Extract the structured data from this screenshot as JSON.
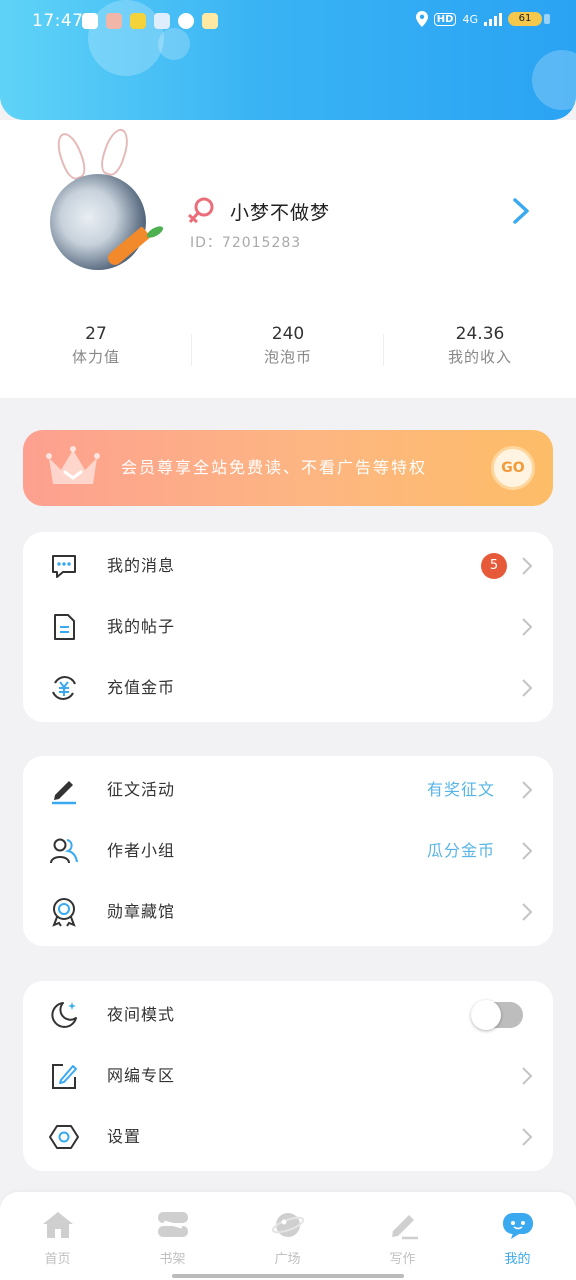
{
  "status_bar": {
    "time": "17:47",
    "net": "4G",
    "hd": "HD",
    "battery": "61",
    "notification_icons": [
      "mail-app-icon",
      "game-app-icon",
      "news-app-icon",
      "star-app-icon",
      "chat-app-icon",
      "emoji-app-icon"
    ]
  },
  "profile": {
    "username": "小梦不做梦",
    "user_id": "ID：72015283",
    "gender_icon": "female-icon",
    "stats": [
      {
        "value": "27",
        "label": "体力值"
      },
      {
        "value": "240",
        "label": "泡泡币"
      },
      {
        "value": "24.36",
        "label": "我的收入"
      }
    ]
  },
  "vip_banner": {
    "text": "会员尊享全站免费读、不看广告等特权",
    "go_label": "GO"
  },
  "menu_group_1": [
    {
      "icon": "message-icon",
      "label": "我的消息",
      "badge": "5"
    },
    {
      "icon": "document-icon",
      "label": "我的帖子"
    },
    {
      "icon": "coin-icon",
      "label": "充值金币"
    }
  ],
  "menu_group_2": [
    {
      "icon": "pen-icon",
      "label": "征文活动",
      "value": "有奖征文"
    },
    {
      "icon": "users-icon",
      "label": "作者小组",
      "value": "瓜分金币"
    },
    {
      "icon": "medal-icon",
      "label": "勋章藏馆"
    }
  ],
  "menu_group_3": [
    {
      "icon": "moon-icon",
      "label": "夜间模式",
      "toggle_on": false
    },
    {
      "icon": "edit-box-icon",
      "label": "网编专区"
    },
    {
      "icon": "settings-icon",
      "label": "设置"
    }
  ],
  "tab_bar": [
    {
      "icon": "home-icon",
      "label": "首页",
      "active": false
    },
    {
      "icon": "bookshelf-icon",
      "label": "书架",
      "active": false
    },
    {
      "icon": "planet-icon",
      "label": "广场",
      "active": false
    },
    {
      "icon": "write-icon",
      "label": "写作",
      "active": false
    },
    {
      "icon": "me-chat-icon",
      "label": "我的",
      "active": true
    }
  ],
  "colors": {
    "header_gradient_start": "#5fd3f7",
    "header_gradient_end": "#2aa3f3",
    "accent_blue": "#3aa9ef",
    "badge_red": "#e65a3a",
    "vip_start": "#fda090",
    "vip_end": "#fdbd67"
  }
}
